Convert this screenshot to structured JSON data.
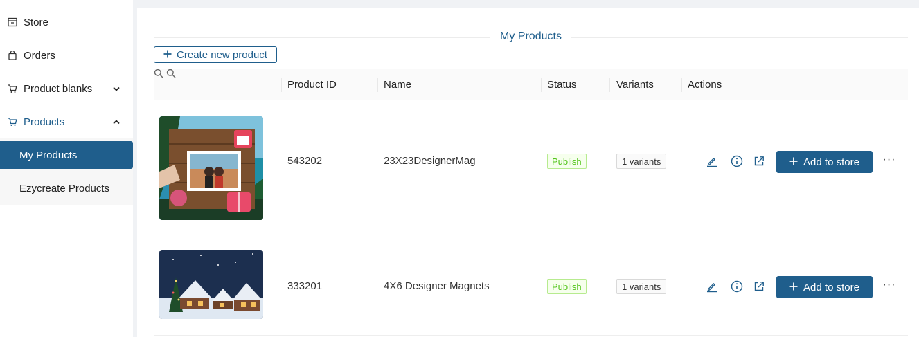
{
  "sidebar": {
    "items": [
      {
        "label": "Store",
        "icon": "store-icon"
      },
      {
        "label": "Orders",
        "icon": "bag-icon"
      },
      {
        "label": "Product blanks",
        "icon": "cart-icon"
      },
      {
        "label": "Products",
        "icon": "cart-icon"
      }
    ],
    "sub_items": [
      {
        "label": "My Products"
      },
      {
        "label": "Ezycreate Products"
      }
    ]
  },
  "main": {
    "title": "My Products",
    "create_button": "Create new product"
  },
  "table": {
    "columns": [
      "Product ID",
      "Name",
      "Status",
      "Variants",
      "Actions"
    ],
    "rows": [
      {
        "id": "543202",
        "name": "23X23DesignerMag",
        "status": "Publish",
        "variants": "1 variants",
        "add_label": "Add to store",
        "more": "···"
      },
      {
        "id": "333201",
        "name": "4X6 Designer Magnets",
        "status": "Publish",
        "variants": "1 variants",
        "add_label": "Add to store",
        "more": "···"
      }
    ]
  },
  "colors": {
    "primary": "#1f5e8c",
    "publish_text": "#52c41a",
    "publish_bg": "#f6ffed",
    "publish_border": "#b7eb8f"
  }
}
